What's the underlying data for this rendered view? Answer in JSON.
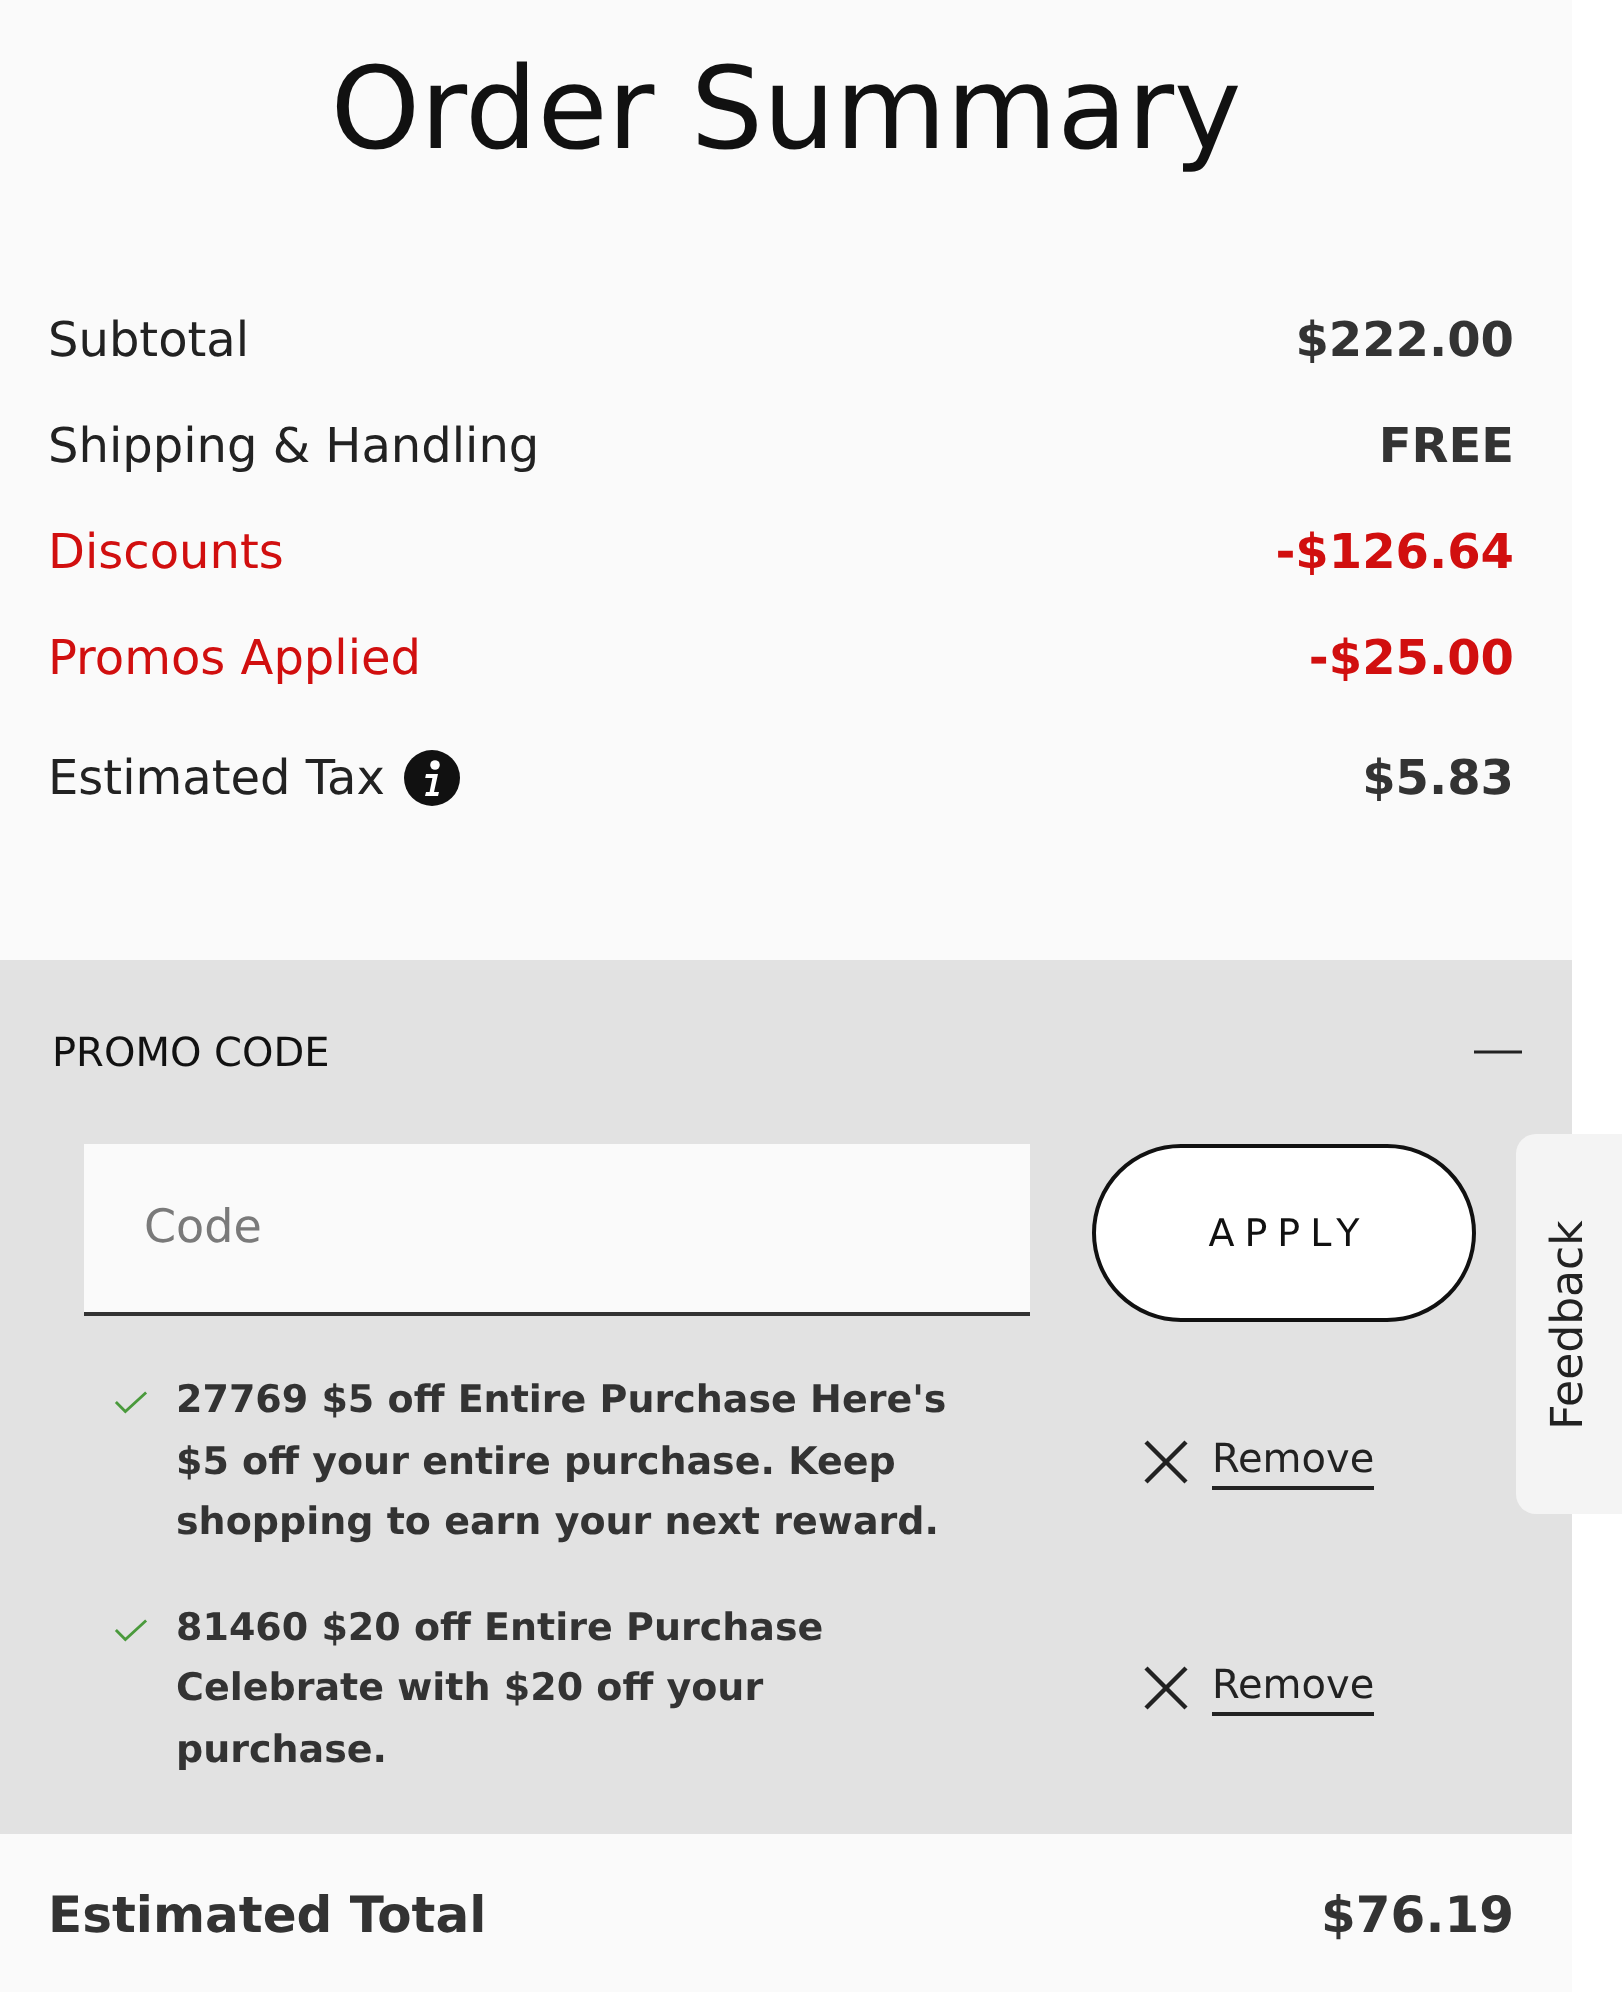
{
  "summary": {
    "title": "Order Summary",
    "rows": [
      {
        "label": "Subtotal",
        "value": "$222.00",
        "kind": "charge"
      },
      {
        "label": "Shipping & Handling",
        "value": "FREE",
        "kind": "charge"
      },
      {
        "label": "Discounts",
        "value": "-$126.64",
        "kind": "discount"
      },
      {
        "label": "Promos Applied",
        "value": "-$25.00",
        "kind": "discount"
      },
      {
        "label": "Estimated Tax",
        "value": "$5.83",
        "kind": "tax"
      }
    ]
  },
  "promo": {
    "heading": "PROMO CODE",
    "expanded": true,
    "field": {
      "placeholder": "Code"
    },
    "apply_button": "APPLY",
    "applied": [
      {
        "text": "27769 $5 off Entire Purchase Here's $5 off your entire purchase. Keep shopping to earn your next reward.",
        "remove_label": "Remove"
      },
      {
        "text": "81460 $20 off Entire Purchase Celebrate with $20 off your purchase.",
        "remove_label": "Remove"
      }
    ]
  },
  "total": {
    "label": "Estimated Total",
    "value": "$76.19"
  },
  "feedback_tab": "Feedback"
}
